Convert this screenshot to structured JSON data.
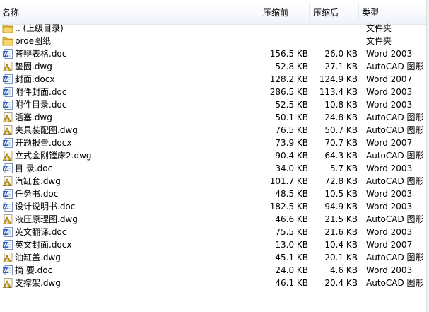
{
  "header": {
    "name": "名称",
    "before": "压缩前",
    "after": "压缩后",
    "type": "类型"
  },
  "icon_colors": {
    "folder": "#e8b93c",
    "word": "#2f62c0",
    "autocad": "#e0a818"
  },
  "files": [
    {
      "name": ".. (上级目录)",
      "before": "",
      "after": "",
      "type": "文件夹",
      "icon": "folder-icon"
    },
    {
      "name": "proe图纸",
      "before": "",
      "after": "",
      "type": "文件夹",
      "icon": "folder-icon"
    },
    {
      "name": "答辩表格.doc",
      "before": "156.5 KB",
      "after": "26.0 KB",
      "type": "Word 2003",
      "icon": "word-doc-icon"
    },
    {
      "name": "垫圈.dwg",
      "before": "52.8 KB",
      "after": "27.1 KB",
      "type": "AutoCAD 图形",
      "icon": "autocad-dwg-icon"
    },
    {
      "name": "封面.docx",
      "before": "128.2 KB",
      "after": "124.9 KB",
      "type": "Word 2007",
      "icon": "word-doc-icon"
    },
    {
      "name": "附件封面.doc",
      "before": "286.5 KB",
      "after": "113.4 KB",
      "type": "Word 2003",
      "icon": "word-doc-icon"
    },
    {
      "name": "附件目录.doc",
      "before": "52.5 KB",
      "after": "10.8 KB",
      "type": "Word 2003",
      "icon": "word-doc-icon"
    },
    {
      "name": "活塞.dwg",
      "before": "50.1 KB",
      "after": "24.8 KB",
      "type": "AutoCAD 图形",
      "icon": "autocad-dwg-icon"
    },
    {
      "name": "夹具装配图.dwg",
      "before": "76.5 KB",
      "after": "50.7 KB",
      "type": "AutoCAD 图形",
      "icon": "autocad-dwg-icon"
    },
    {
      "name": "开题报告.docx",
      "before": "73.9 KB",
      "after": "70.7 KB",
      "type": "Word 2007",
      "icon": "word-doc-icon"
    },
    {
      "name": "立式金刚镗床2.dwg",
      "before": "90.4 KB",
      "after": "64.3 KB",
      "type": "AutoCAD 图形",
      "icon": "autocad-dwg-icon"
    },
    {
      "name": "目  录.doc",
      "before": "34.0 KB",
      "after": "5.7 KB",
      "type": "Word 2003",
      "icon": "word-doc-icon"
    },
    {
      "name": "汽缸套.dwg",
      "before": "101.7 KB",
      "after": "72.8 KB",
      "type": "AutoCAD 图形",
      "icon": "autocad-dwg-icon"
    },
    {
      "name": "任务书.doc",
      "before": "48.5 KB",
      "after": "10.5 KB",
      "type": "Word 2003",
      "icon": "word-doc-icon"
    },
    {
      "name": "设计说明书.doc",
      "before": "182.5 KB",
      "after": "94.9 KB",
      "type": "Word 2003",
      "icon": "word-doc-icon"
    },
    {
      "name": "液压原理图.dwg",
      "before": "46.6 KB",
      "after": "21.5 KB",
      "type": "AutoCAD 图形",
      "icon": "autocad-dwg-icon"
    },
    {
      "name": "英文翻译.doc",
      "before": "75.5 KB",
      "after": "21.6 KB",
      "type": "Word 2003",
      "icon": "word-doc-icon"
    },
    {
      "name": "英文封面.docx",
      "before": "13.0 KB",
      "after": "10.4 KB",
      "type": "Word 2007",
      "icon": "word-doc-icon"
    },
    {
      "name": "油缸盖.dwg",
      "before": "45.1 KB",
      "after": "20.1 KB",
      "type": "AutoCAD 图形",
      "icon": "autocad-dwg-icon"
    },
    {
      "name": "摘  要.doc",
      "before": "24.0 KB",
      "after": "4.6 KB",
      "type": "Word 2003",
      "icon": "word-doc-icon"
    },
    {
      "name": "支撑架.dwg",
      "before": "46.1 KB",
      "after": "20.4 KB",
      "type": "AutoCAD 图形",
      "icon": "autocad-dwg-icon"
    }
  ]
}
